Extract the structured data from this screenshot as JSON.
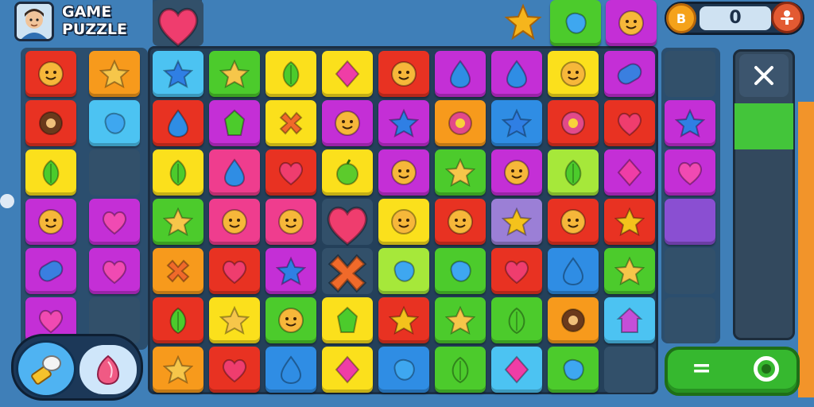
{
  "header": {
    "title_line1": "GAME",
    "title_line2": "PUZZLE",
    "score": "0"
  },
  "colors": {
    "red": "#e83222",
    "orange": "#f79a1c",
    "yellow": "#fbe01c",
    "green": "#4ccb2c",
    "cyan": "#4cc3f2",
    "blue": "#2f8de4",
    "pink": "#ef3d8e",
    "magenta": "#c42fd6",
    "purple": "#8a4fd2",
    "lime": "#a6e83a",
    "lavender": "#9b7fd6",
    "darkred": "#c91f1f"
  },
  "left_tiles": [
    {
      "bg": "red",
      "shape": "face"
    },
    {
      "bg": "orange",
      "shape": "star"
    },
    {
      "bg": "red",
      "shape": "circle"
    },
    {
      "bg": "cyan",
      "shape": "blob"
    },
    {
      "bg": "yellow",
      "shape": "leaf"
    },
    {
      "bg": "empty",
      "shape": ""
    },
    {
      "bg": "magenta",
      "shape": "face"
    },
    {
      "bg": "magenta",
      "shape": "heart"
    },
    {
      "bg": "magenta",
      "shape": "capsule"
    },
    {
      "bg": "magenta",
      "shape": "heart"
    },
    {
      "bg": "magenta",
      "shape": "heart"
    },
    {
      "bg": "empty",
      "shape": ""
    }
  ],
  "grid": [
    [
      {
        "bg": "cyan",
        "shape": "star"
      },
      {
        "bg": "green",
        "shape": "star"
      },
      {
        "bg": "yellow",
        "shape": "leaf"
      },
      {
        "bg": "yellow",
        "shape": "diamond"
      },
      {
        "bg": "red",
        "shape": "face"
      },
      {
        "bg": "magenta",
        "shape": "drop"
      },
      {
        "bg": "magenta",
        "shape": "drop"
      },
      {
        "bg": "yellow",
        "shape": "face"
      },
      {
        "bg": "magenta",
        "shape": "capsule"
      }
    ],
    [
      {
        "bg": "red",
        "shape": "drop"
      },
      {
        "bg": "magenta",
        "shape": "gem"
      },
      {
        "bg": "yellow",
        "shape": "cross"
      },
      {
        "bg": "magenta",
        "shape": "face"
      },
      {
        "bg": "magenta",
        "shape": "star"
      },
      {
        "bg": "orange",
        "shape": "flower"
      },
      {
        "bg": "blue",
        "shape": "star"
      },
      {
        "bg": "red",
        "shape": "flower"
      },
      {
        "bg": "red",
        "shape": "heart"
      }
    ],
    [
      {
        "bg": "yellow",
        "shape": "leaf"
      },
      {
        "bg": "pink",
        "shape": "drop"
      },
      {
        "bg": "red",
        "shape": "heart"
      },
      {
        "bg": "yellow",
        "shape": "fruit"
      },
      {
        "bg": "magenta",
        "shape": "face"
      },
      {
        "bg": "green",
        "shape": "star"
      },
      {
        "bg": "magenta",
        "shape": "face"
      },
      {
        "bg": "lime",
        "shape": "leaf"
      },
      {
        "bg": "magenta",
        "shape": "diamond"
      }
    ],
    [
      {
        "bg": "green",
        "shape": "star"
      },
      {
        "bg": "pink",
        "shape": "face"
      },
      {
        "bg": "pink",
        "shape": "face"
      },
      {
        "bg": "empty",
        "shape": "heart"
      },
      {
        "bg": "yellow",
        "shape": "face"
      },
      {
        "bg": "red",
        "shape": "face"
      },
      {
        "bg": "lavender",
        "shape": "star"
      },
      {
        "bg": "red",
        "shape": "face"
      },
      {
        "bg": "red",
        "shape": "star"
      }
    ],
    [
      {
        "bg": "orange",
        "shape": "cross"
      },
      {
        "bg": "red",
        "shape": "heart"
      },
      {
        "bg": "magenta",
        "shape": "star"
      },
      {
        "bg": "empty",
        "shape": "cross"
      },
      {
        "bg": "lime",
        "shape": "blob"
      },
      {
        "bg": "green",
        "shape": "blob"
      },
      {
        "bg": "red",
        "shape": "heart"
      },
      {
        "bg": "blue",
        "shape": "drop"
      },
      {
        "bg": "green",
        "shape": "star"
      }
    ],
    [
      {
        "bg": "red",
        "shape": "leaf"
      },
      {
        "bg": "yellow",
        "shape": "star"
      },
      {
        "bg": "green",
        "shape": "face"
      },
      {
        "bg": "yellow",
        "shape": "gem"
      },
      {
        "bg": "red",
        "shape": "star"
      },
      {
        "bg": "green",
        "shape": "star"
      },
      {
        "bg": "green",
        "shape": "leaf"
      },
      {
        "bg": "orange",
        "shape": "circle"
      },
      {
        "bg": "cyan",
        "shape": "house"
      }
    ],
    [
      {
        "bg": "orange",
        "shape": "star"
      },
      {
        "bg": "red",
        "shape": "heart"
      },
      {
        "bg": "blue",
        "shape": "drop"
      },
      {
        "bg": "yellow",
        "shape": "diamond"
      },
      {
        "bg": "blue",
        "shape": "blob"
      },
      {
        "bg": "green",
        "shape": "leaf"
      },
      {
        "bg": "cyan",
        "shape": "diamond"
      },
      {
        "bg": "green",
        "shape": "blob"
      },
      {
        "bg": "empty",
        "shape": ""
      }
    ]
  ],
  "right_tiles": [
    {
      "bg": "empty",
      "shape": ""
    },
    {
      "bg": "magenta",
      "shape": "star"
    },
    {
      "bg": "magenta",
      "shape": "heart"
    },
    {
      "bg": "purple",
      "shape": ""
    },
    {
      "bg": "empty",
      "shape": ""
    },
    {
      "bg": "empty",
      "shape": ""
    }
  ],
  "top_tiles": [
    {
      "bg": "green",
      "shape": "blob"
    },
    {
      "bg": "magenta",
      "shape": "face"
    }
  ],
  "top_slot": {
    "bg": "empty",
    "shape": "heart"
  },
  "booster": {
    "left_icon": "hammer-icon",
    "right_icon": "gem-icon"
  },
  "buttons": {
    "close_icon": "close-icon",
    "play_icon": "menu-icon",
    "settings_icon": "settings-icon"
  }
}
